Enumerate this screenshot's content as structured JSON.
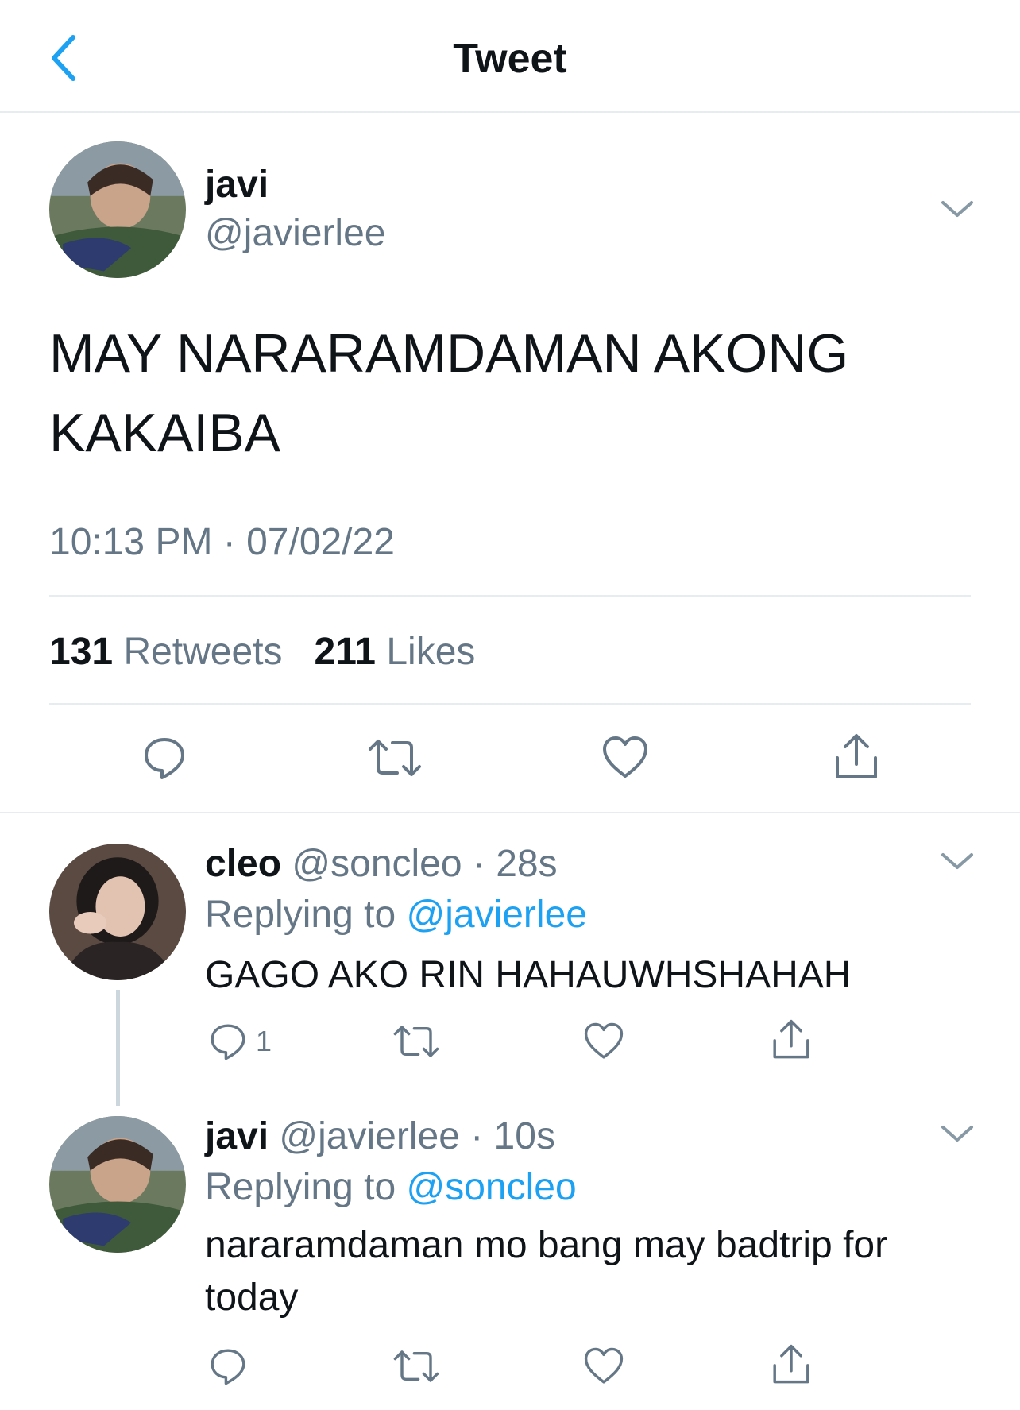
{
  "header": {
    "title": "Tweet"
  },
  "tweet": {
    "name": "javi",
    "handle": "@javierlee",
    "text_line1": "MAY NARARAMDAMAN AKONG",
    "text_line2": "KAKAIBA",
    "timestamp": "10:13 PM · 07/02/22",
    "retweets_count": "131",
    "retweets_label": "Retweets",
    "likes_count": "211",
    "likes_label": "Likes"
  },
  "replies": [
    {
      "name": "cleo",
      "handle": "@soncleo",
      "time": "28s",
      "replying_label": "Replying to",
      "replying_to": "@javierlee",
      "text": "GAGO AKO RIN HAHAUWHSHAHAH",
      "reply_count": "1"
    },
    {
      "name": "javi",
      "handle": "@javierlee",
      "time": "10s",
      "replying_label": "Replying to",
      "replying_to": "@soncleo",
      "text": "nararamdaman mo bang may badtrip for today"
    }
  ],
  "colors": {
    "accent": "#1da1f2",
    "secondary_text": "#657786",
    "divider": "#e6ecf0"
  },
  "icons": [
    "back-chevron-icon",
    "chevron-down-icon",
    "reply-icon",
    "retweet-icon",
    "like-icon",
    "share-icon"
  ]
}
